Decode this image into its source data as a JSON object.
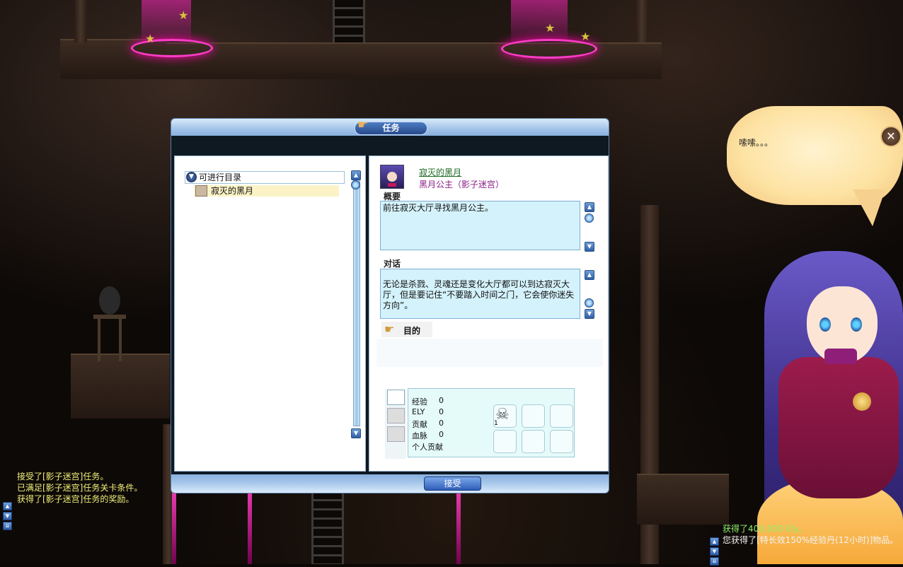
{
  "window": {
    "title": "任务",
    "accept_label": "接受"
  },
  "quest_list": {
    "header_label": "可进行目录",
    "items": [
      {
        "label": "寂灭的黑月"
      }
    ]
  },
  "quest_detail": {
    "quest_name": "寂灭的黑月",
    "npc_name": "黑月公主（影子迷宫）",
    "summary_label": "概要",
    "summary_text": "前往寂灭大厅寻找黑月公主。",
    "dialogue_label": "对话",
    "dialogue_text": "无论是杀戮、灵魂还是变化大厅都可以到达寂灭大厅，但是要记住“不要踏入时间之门，它会使你迷失方向”。",
    "goal_label": "目的"
  },
  "rewards": {
    "rows": [
      {
        "label": "经验",
        "value": "0"
      },
      {
        "label": "ELY",
        "value": "0"
      },
      {
        "label": "贡献",
        "value": "0"
      },
      {
        "label": "血脉",
        "value": "0"
      },
      {
        "label": "个人贡献",
        "value": ""
      }
    ],
    "items": [
      {
        "icon": "skull-icon",
        "qty": "1"
      }
    ]
  },
  "npc_bubble": {
    "text": "嗦嗦。。。"
  },
  "chat_left": [
    "接受了[影子迷宫]任务。",
    "已满足[影子迷宫]任务关卡条件。",
    "获得了[影子迷宫]任务的奖励。"
  ],
  "chat_right": [
    "获得了400,000 Ely。",
    "您获得了[特长效150%经验丹(12小时)]物品。"
  ],
  "colors": {
    "quest_name": "#1d6b22",
    "npc_name": "#8a1c86",
    "chat_system": "#f3f07a",
    "chat_gain": "#8ef06a"
  }
}
